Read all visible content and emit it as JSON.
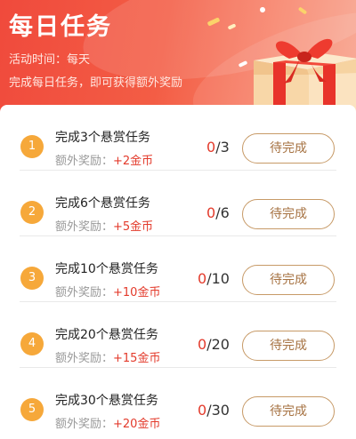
{
  "banner": {
    "title": "每日任务",
    "activity_time": "活动时间：每天",
    "description": "完成每日任务，即可获得额外奖励"
  },
  "reward_prefix": "额外奖励：",
  "tasks": [
    {
      "number": "1",
      "title": "完成3个悬赏任务",
      "reward": "+2金币",
      "current": "0",
      "total": "/3",
      "button": "待完成"
    },
    {
      "number": "2",
      "title": "完成6个悬赏任务",
      "reward": "+5金币",
      "current": "0",
      "total": "/6",
      "button": "待完成"
    },
    {
      "number": "3",
      "title": "完成10个悬赏任务",
      "reward": "+10金币",
      "current": "0",
      "total": "/10",
      "button": "待完成"
    },
    {
      "number": "4",
      "title": "完成20个悬赏任务",
      "reward": "+15金币",
      "current": "0",
      "total": "/20",
      "button": "待完成"
    },
    {
      "number": "5",
      "title": "完成30个悬赏任务",
      "reward": "+20金币",
      "current": "0",
      "total": "/30",
      "button": "待完成"
    }
  ],
  "colors": {
    "accent": "#e33a2b",
    "badge": "#f6a83a",
    "button_border": "#c79a67"
  }
}
